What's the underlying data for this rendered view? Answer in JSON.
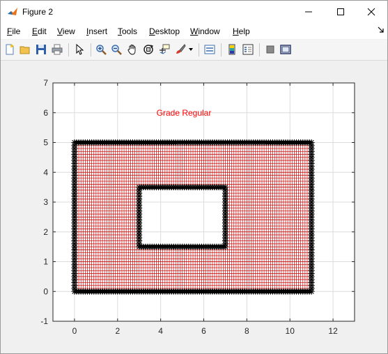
{
  "window": {
    "title": "Figure 2"
  },
  "menu": {
    "items": [
      {
        "label": "File"
      },
      {
        "label": "Edit"
      },
      {
        "label": "View"
      },
      {
        "label": "Insert"
      },
      {
        "label": "Tools"
      },
      {
        "label": "Desktop"
      },
      {
        "label": "Window"
      },
      {
        "label": "Help"
      }
    ]
  },
  "toolbar": {
    "icons": [
      "new-figure-icon",
      "open-file-icon",
      "save-icon",
      "print-icon",
      "select-arrow-icon",
      "zoom-in-icon",
      "zoom-out-icon",
      "pan-hand-icon",
      "rotate-3d-icon",
      "data-cursor-icon",
      "brush-icon",
      "brush-dropdown-icon",
      "link-plot-icon",
      "colorbar-icon",
      "legend-icon",
      "hide-plot-tools-icon",
      "show-plot-tools-icon"
    ]
  },
  "colors": {
    "grid_line": "#cc0000",
    "marker": "#000000",
    "title_text": "#ff0000"
  },
  "chart_data": {
    "type": "scatter",
    "title": "Grade Regular",
    "xlabel": "",
    "ylabel": "",
    "xlim": [
      -1,
      13
    ],
    "ylim": [
      -1,
      7
    ],
    "xticks": [
      0,
      2,
      4,
      6,
      8,
      10,
      12
    ],
    "yticks": [
      -1,
      0,
      1,
      2,
      3,
      4,
      5,
      6,
      7
    ],
    "grid": true,
    "mesh": {
      "outer": {
        "x": [
          0,
          11
        ],
        "y": [
          0,
          5
        ]
      },
      "hole": {
        "x": [
          3,
          7
        ],
        "y": [
          1.5,
          3.5
        ]
      },
      "spacing": 0.1
    },
    "marker": "*"
  }
}
